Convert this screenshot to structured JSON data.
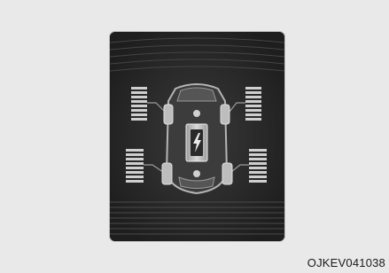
{
  "figure": {
    "code": "OJKEV041038",
    "icon": "ev-battery-lightning-icon",
    "colors": {
      "page_bg": "#e9e9ea",
      "panel_bg": "#2a2a2a",
      "car_fill": "#cfcfcf",
      "tire_fill": "#bdbdbd",
      "warning_stripes": "#cfcfcf"
    }
  }
}
